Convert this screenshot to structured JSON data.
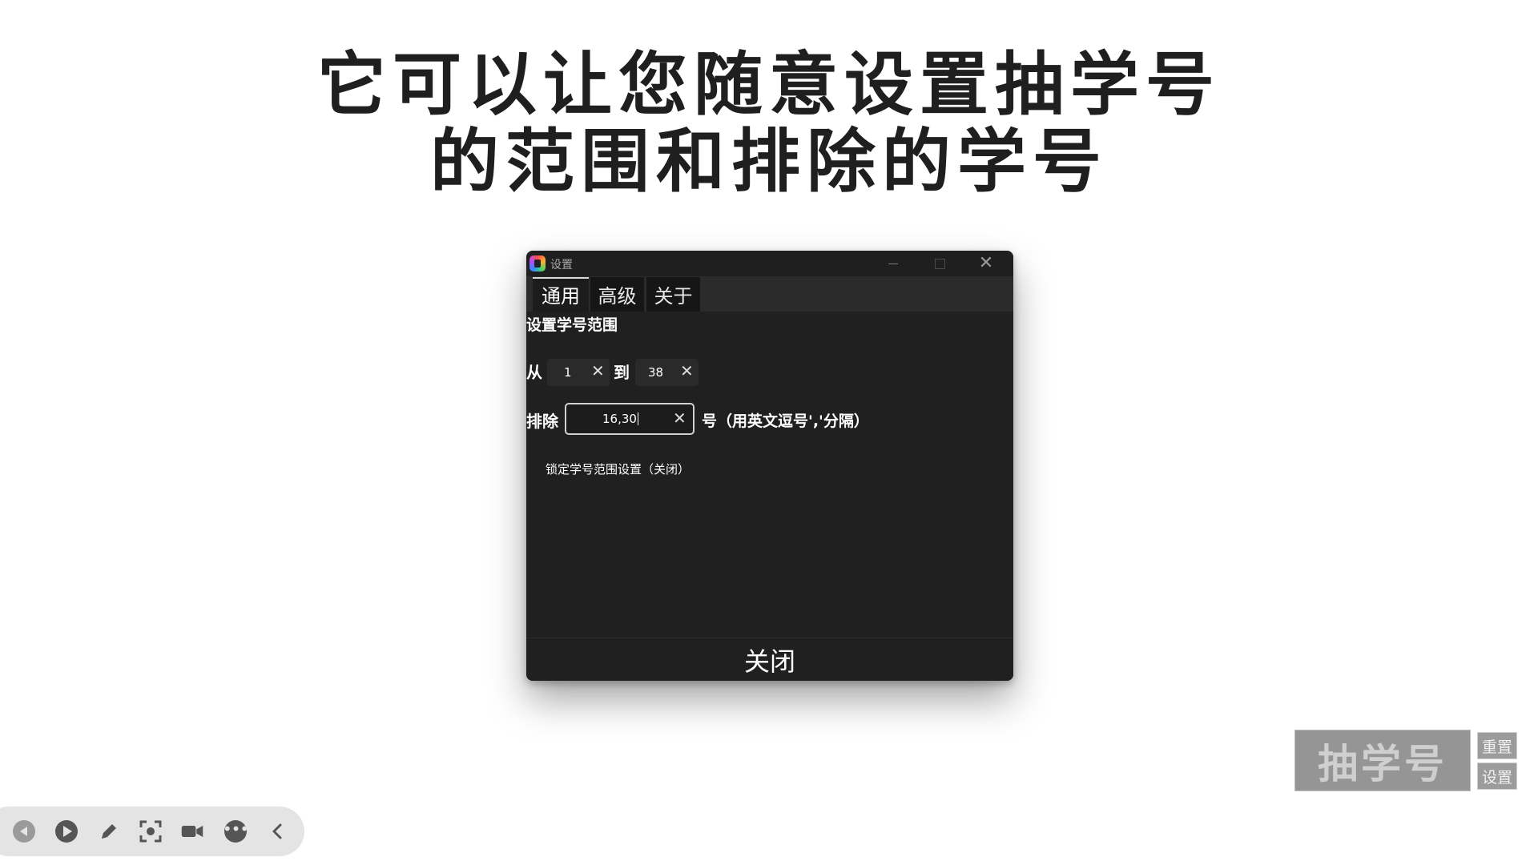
{
  "headline": {
    "line1": "它可以让您随意设置抽学号",
    "line2": "的范围和排除的学号"
  },
  "settings_window": {
    "title": "设置",
    "tabs": [
      {
        "label": "通用",
        "selected": true
      },
      {
        "label": "高级",
        "selected": false
      },
      {
        "label": "关于",
        "selected": false
      }
    ],
    "section_title": "设置学号范围",
    "range": {
      "from_label": "从",
      "from_value": "1",
      "to_label": "到",
      "to_value": "38"
    },
    "exclude": {
      "label": "排除",
      "value": "16,30",
      "hint": "号（用英文逗号','分隔）"
    },
    "lock_option": "锁定学号范围设置（关闭）",
    "close_button": "关闭"
  },
  "widget": {
    "draw_button": "抽学号",
    "reset_button": "重置",
    "settings_button": "设置"
  },
  "player_toolbar": {
    "icons": [
      "prev-icon",
      "play-icon",
      "pen-icon",
      "screenshot-icon",
      "camera-icon",
      "more-icon",
      "collapse-icon"
    ]
  },
  "colors": {
    "window_bg": "#202020",
    "widget_bg": "#959595",
    "headline": "#1f1f1f"
  }
}
